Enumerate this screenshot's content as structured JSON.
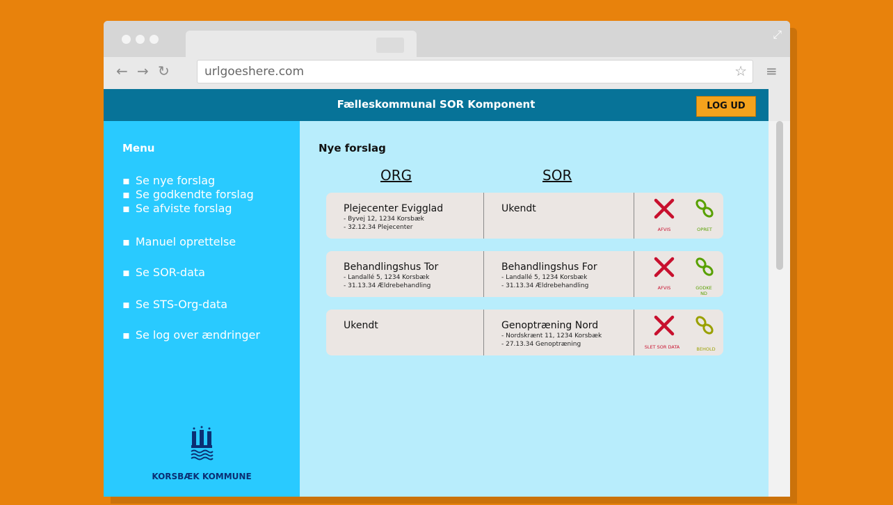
{
  "browser": {
    "url": "urlgoeshere.com",
    "icons": [
      "back-arrow-icon",
      "forward-arrow-icon",
      "reload-icon",
      "star-icon",
      "hamburger-menu-icon",
      "expand-icon"
    ]
  },
  "app": {
    "title": "Fælleskommunal SOR Komponent",
    "logout_label": "LOG UD"
  },
  "sidebar": {
    "menu_title": "Menu",
    "items": [
      "Se nye forslag",
      "Se godkendte forslag",
      "Se afviste forslag",
      "Manuel oprettelse",
      "Se SOR-data",
      "Se STS-Org-data",
      "Se log over ændringer"
    ],
    "org_name": "KORSBÆK KOMMUNE"
  },
  "main": {
    "title": "Nye forslag",
    "col_org": "ORG",
    "col_sor": "SOR",
    "rows": [
      {
        "org": {
          "name": "Plejecenter Evigglad",
          "line1": "- Byvej 12, 1234 Korsbæk",
          "line2": "- 32.12.34 Plejecenter"
        },
        "sor": {
          "name": "Ukendt",
          "line1": "",
          "line2": ""
        },
        "reject_label": "AFVIS",
        "accept_label": "OPRET"
      },
      {
        "org": {
          "name": "Behandlingshus Tor",
          "line1": "- Landallé 5, 1234 Korsbæk",
          "line2": "- 31.13.34 Ældrebehandling"
        },
        "sor": {
          "name": "Behandlingshus For",
          "line1": "- Landallé 5, 1234 Korsbæk",
          "line2": "- 31.13.34 Ældrebehandling"
        },
        "reject_label": "AFVIS",
        "accept_label": "GODKEND"
      },
      {
        "org": {
          "name": "Ukendt",
          "line1": "",
          "line2": ""
        },
        "sor": {
          "name": "Genoptræning Nord",
          "line1": "- Nordskrænt 11, 1234 Korsbæk",
          "line2": "- 27.13.34 Genoptræning"
        },
        "reject_label": "SLET SOR DATA",
        "accept_label": "BEHOLD"
      }
    ]
  },
  "colors": {
    "background": "#e8820c",
    "header": "#077398",
    "sidebar": "#29caff",
    "main": "#b8edfc",
    "logout": "#f4a21c",
    "reject": "#c8102e",
    "accept": "#58a000",
    "accept_olive": "#9aa000"
  }
}
